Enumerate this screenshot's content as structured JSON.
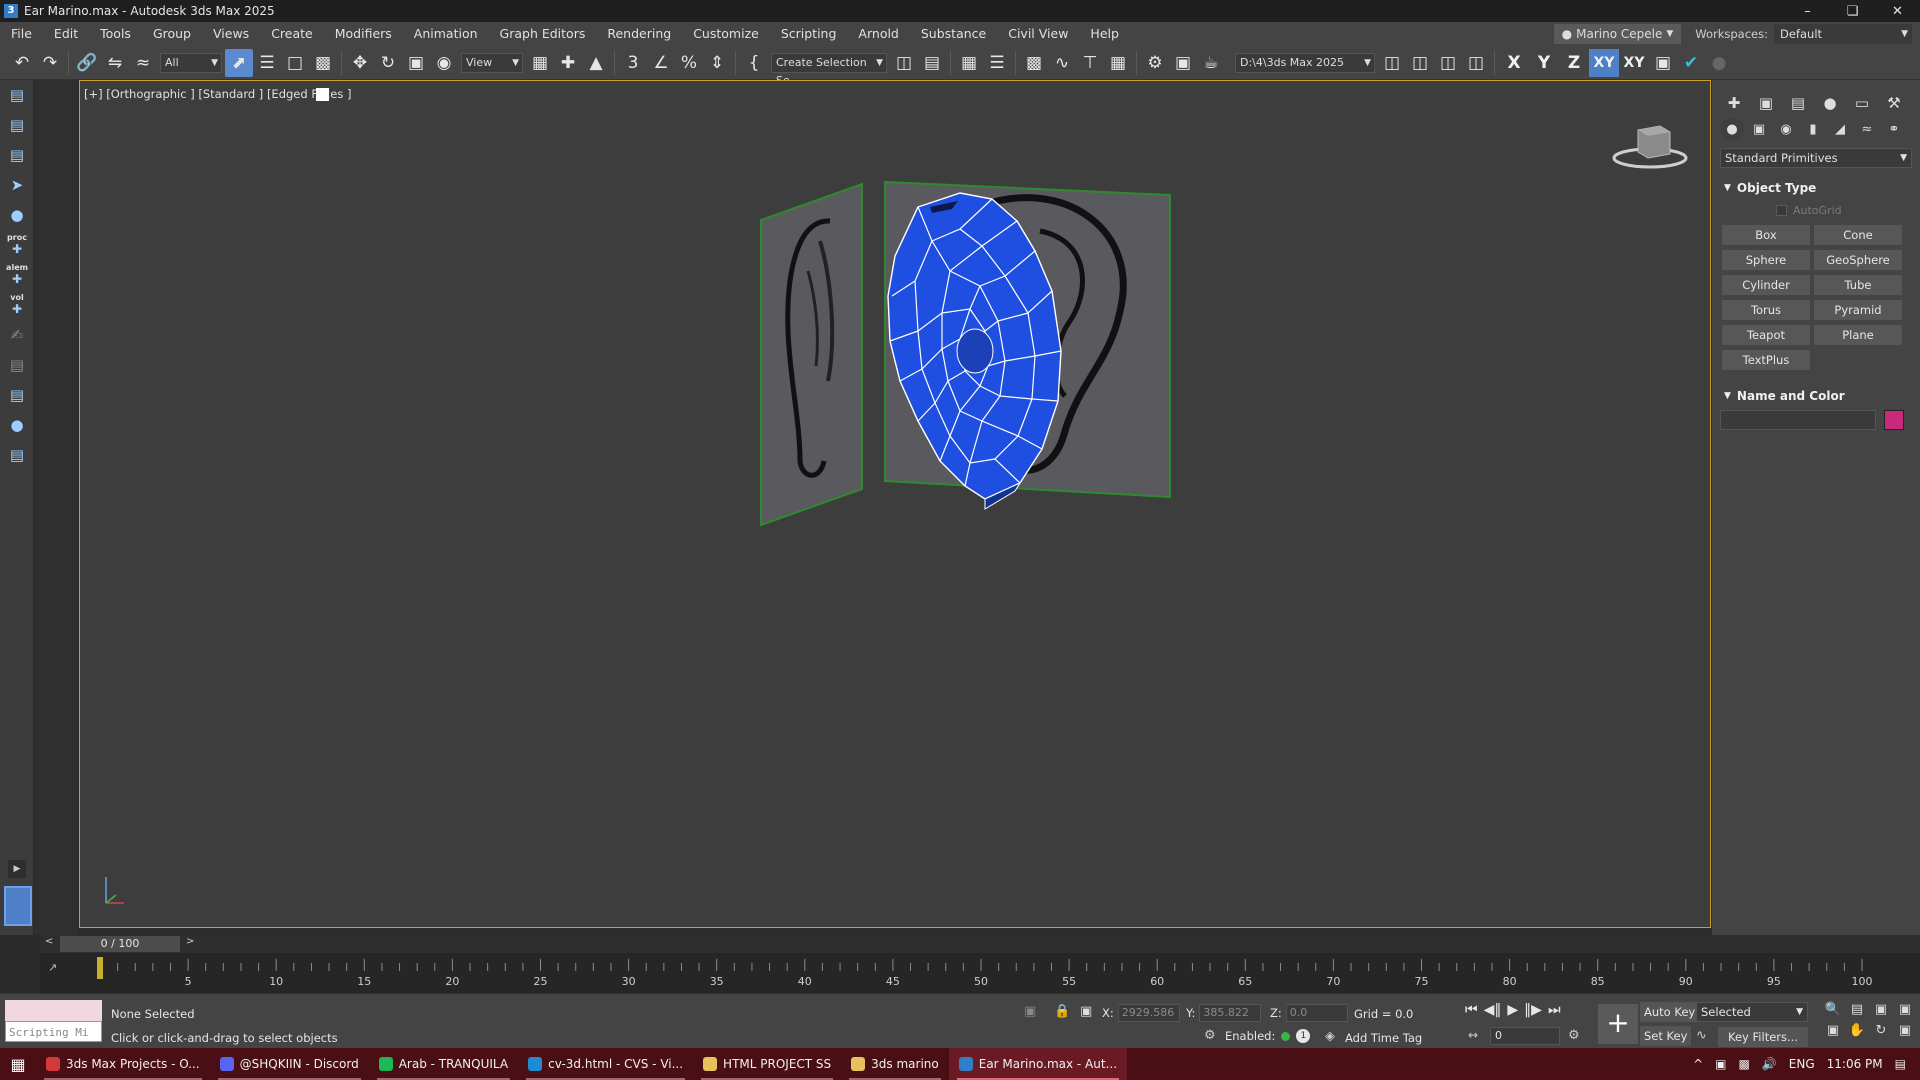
{
  "window": {
    "title": "Ear Marino.max - Autodesk 3ds Max 2025",
    "app_icon": "3ds-max-icon"
  },
  "menu": {
    "items": [
      "File",
      "Edit",
      "Tools",
      "Group",
      "Views",
      "Create",
      "Modifiers",
      "Animation",
      "Graph Editors",
      "Rendering",
      "Customize",
      "Scripting",
      "Arnold",
      "Substance",
      "Civil View",
      "Help"
    ],
    "user": "Marino Cepele",
    "workspaces_label": "Workspaces:",
    "workspace_value": "Default"
  },
  "toolbar": {
    "filter_value": "All",
    "refcoord_value": "View",
    "selection_set_value": "Create Selection Se",
    "project_path": "D:\\4\\3ds Max 2025",
    "axis_labels": [
      "X",
      "Y",
      "Z",
      "XY",
      "XY"
    ]
  },
  "left_strip": {
    "labels": [
      "proc",
      "alem",
      "vol"
    ]
  },
  "viewport": {
    "label": "[+] [Orthographic ] [Standard ] [Edged Faces ]",
    "mesh_color": "#1f4fe0",
    "frame_color": "#c9a227"
  },
  "command_panel": {
    "category_dropdown": "Standard Primitives",
    "object_type": {
      "title": "Object Type",
      "autogrid": "AutoGrid",
      "buttons": [
        "Box",
        "Cone",
        "Sphere",
        "GeoSphere",
        "Cylinder",
        "Tube",
        "Torus",
        "Pyramid",
        "Teapot",
        "Plane",
        "TextPlus"
      ]
    },
    "name_and_color": {
      "title": "Name and Color",
      "color": "#c82a7d"
    }
  },
  "timeline": {
    "frame_display": "0 / 100",
    "ticks": [
      5,
      10,
      15,
      20,
      25,
      30,
      35,
      40,
      45,
      50,
      55,
      60,
      65,
      70,
      75,
      80,
      85,
      90,
      95,
      100
    ],
    "max_frame": 100
  },
  "status": {
    "maxscript_placeholder": "Scripting Mi",
    "selection_status": "None Selected",
    "prompt": "Click or click-and-drag to select objects",
    "x_label": "X:",
    "x_value": "2929.586",
    "y_label": "Y:",
    "y_value": "385.822",
    "z_label": "Z:",
    "z_value": "0.0",
    "grid": "Grid = 0.0",
    "enabled_label": "Enabled:",
    "enabled_num": "1",
    "add_time_tag": "Add Time Tag",
    "auto_key": "Auto Key",
    "set_key": "Set Key",
    "key_mode_value": "Selected",
    "current_frame": "0",
    "key_filters": "Key Filters..."
  },
  "taskbar": {
    "tasks": [
      {
        "label": "3ds Max Projects - O...",
        "color": "#d23a3a"
      },
      {
        "label": "@SHQKIIN - Discord",
        "color": "#5865f2"
      },
      {
        "label": "Arab - TRANQUILA",
        "color": "#1db954"
      },
      {
        "label": "cv-3d.html - CVS - Vi...",
        "color": "#1f8ad2"
      },
      {
        "label": "HTML PROJECT SS",
        "color": "#e8c15a"
      },
      {
        "label": "3ds marino",
        "color": "#e8c15a"
      },
      {
        "label": "Ear Marino.max - Aut...",
        "color": "#2f7fc8"
      }
    ],
    "language": "ENG",
    "time": "11:06 PM"
  }
}
